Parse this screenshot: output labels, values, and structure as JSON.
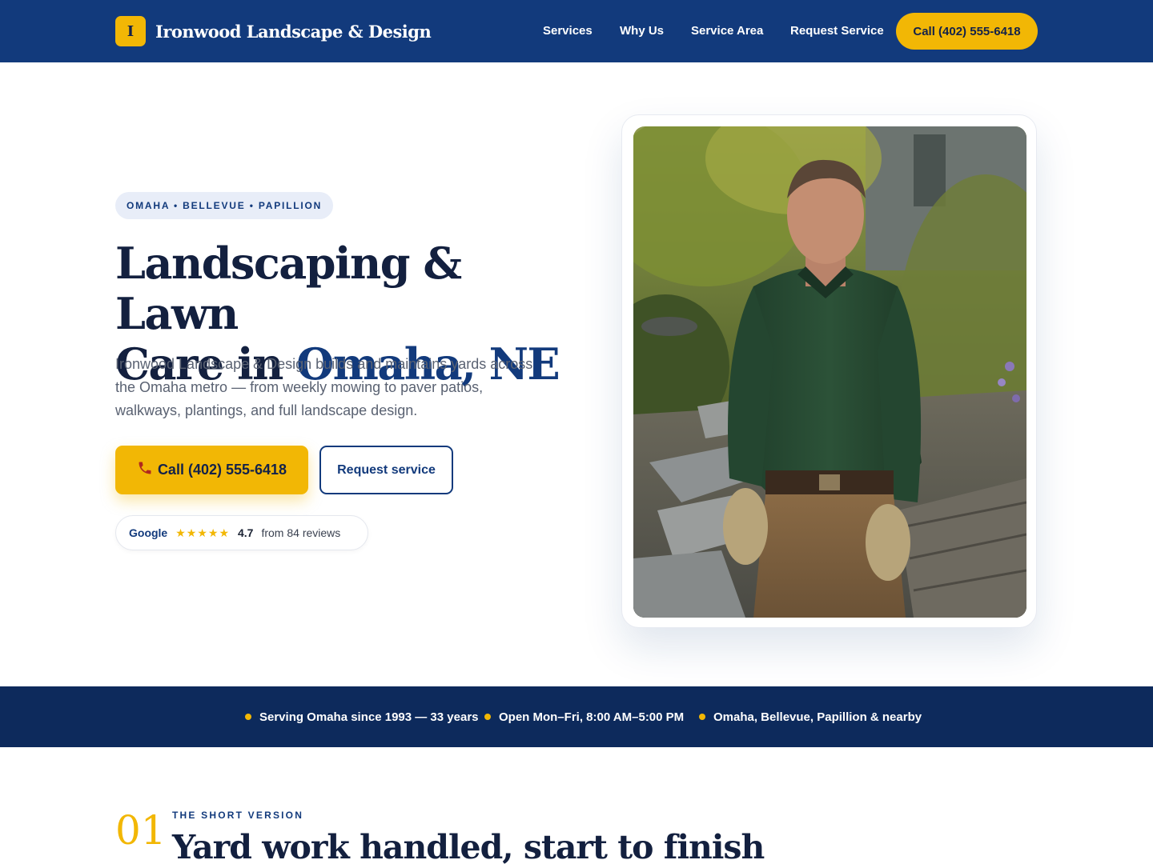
{
  "header": {
    "brand_initial": "I",
    "brand_name": "Ironwood Landscape & Design",
    "nav": [
      "Services",
      "Why Us",
      "Service Area",
      "Request Service"
    ],
    "call_label": "Call (402) 555-6418"
  },
  "hero": {
    "location_pill": "OMAHA • BELLEVUE • PAPILLION",
    "title_line1": "Landscaping & Lawn",
    "title_line2_prefix": "Care in ",
    "title_line2_accent": "Omaha, NE",
    "description": "Ironwood Landscape & Design builds and maintains yards across the Omaha metro — from weekly mowing to paver patios, walkways, plantings, and full landscape design.",
    "call_button": "Call (402) 555-6418",
    "call_icon": "phone-icon",
    "request_button": "Request service",
    "rating": {
      "source": "Google",
      "stars": "★★★★★",
      "score": "4.7",
      "count": "from 84 reviews"
    }
  },
  "info_band": [
    "Serving Omaha since 1993 — 33 years",
    "Open Mon–Fri, 8:00 AM–5:00 PM",
    "Omaha, Bellevue, Papillion & nearby"
  ],
  "section": {
    "number": "01",
    "kicker": "THE SHORT VERSION",
    "title": "Yard work handled, start to finish"
  },
  "colors": {
    "navy": "#123a7c",
    "dark_navy": "#0d2a5c",
    "gold": "#f2b705",
    "ink": "#13203f"
  }
}
